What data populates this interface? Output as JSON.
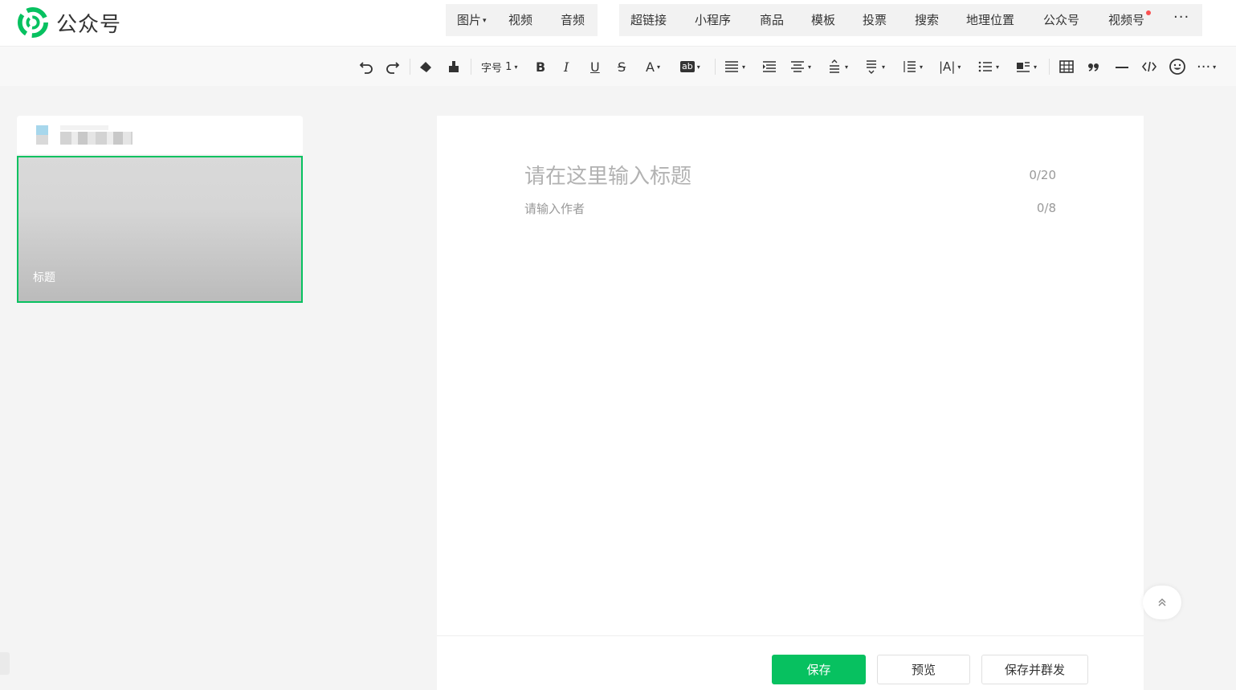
{
  "header": {
    "logo_text": "公众号",
    "insert_group_1": [
      {
        "label": "图片",
        "has_dropdown": true
      },
      {
        "label": "视频",
        "has_dropdown": false
      },
      {
        "label": "音频",
        "has_dropdown": false
      }
    ],
    "insert_group_2": [
      {
        "label": "超链接"
      },
      {
        "label": "小程序"
      },
      {
        "label": "商品"
      },
      {
        "label": "模板"
      },
      {
        "label": "投票"
      },
      {
        "label": "搜索"
      },
      {
        "label": "地理位置"
      },
      {
        "label": "公众号"
      },
      {
        "label": "视频号",
        "has_notification_dot": true
      }
    ],
    "more_label": "···"
  },
  "toolbar": {
    "font_size_label": "字号",
    "font_size_value": "1",
    "bold_label": "B",
    "italic_label": "I",
    "underline_label": "U",
    "strike_label": "S",
    "font_color_label": "A",
    "bg_color_label": "ab",
    "letter_spacing_label": "|A|",
    "more_label": "···"
  },
  "article_list": {
    "cover_title": "标题"
  },
  "editor": {
    "title_placeholder": "请在这里输入标题",
    "title_value": "",
    "title_count": "0/20",
    "author_placeholder": "请输入作者",
    "author_value": "",
    "author_count": "0/8"
  },
  "actions": {
    "save_label": "保存",
    "preview_label": "预览",
    "save_publish_label": "保存并群发"
  },
  "colors": {
    "brand_green": "#07c160",
    "notification_red": "#fa5151"
  }
}
